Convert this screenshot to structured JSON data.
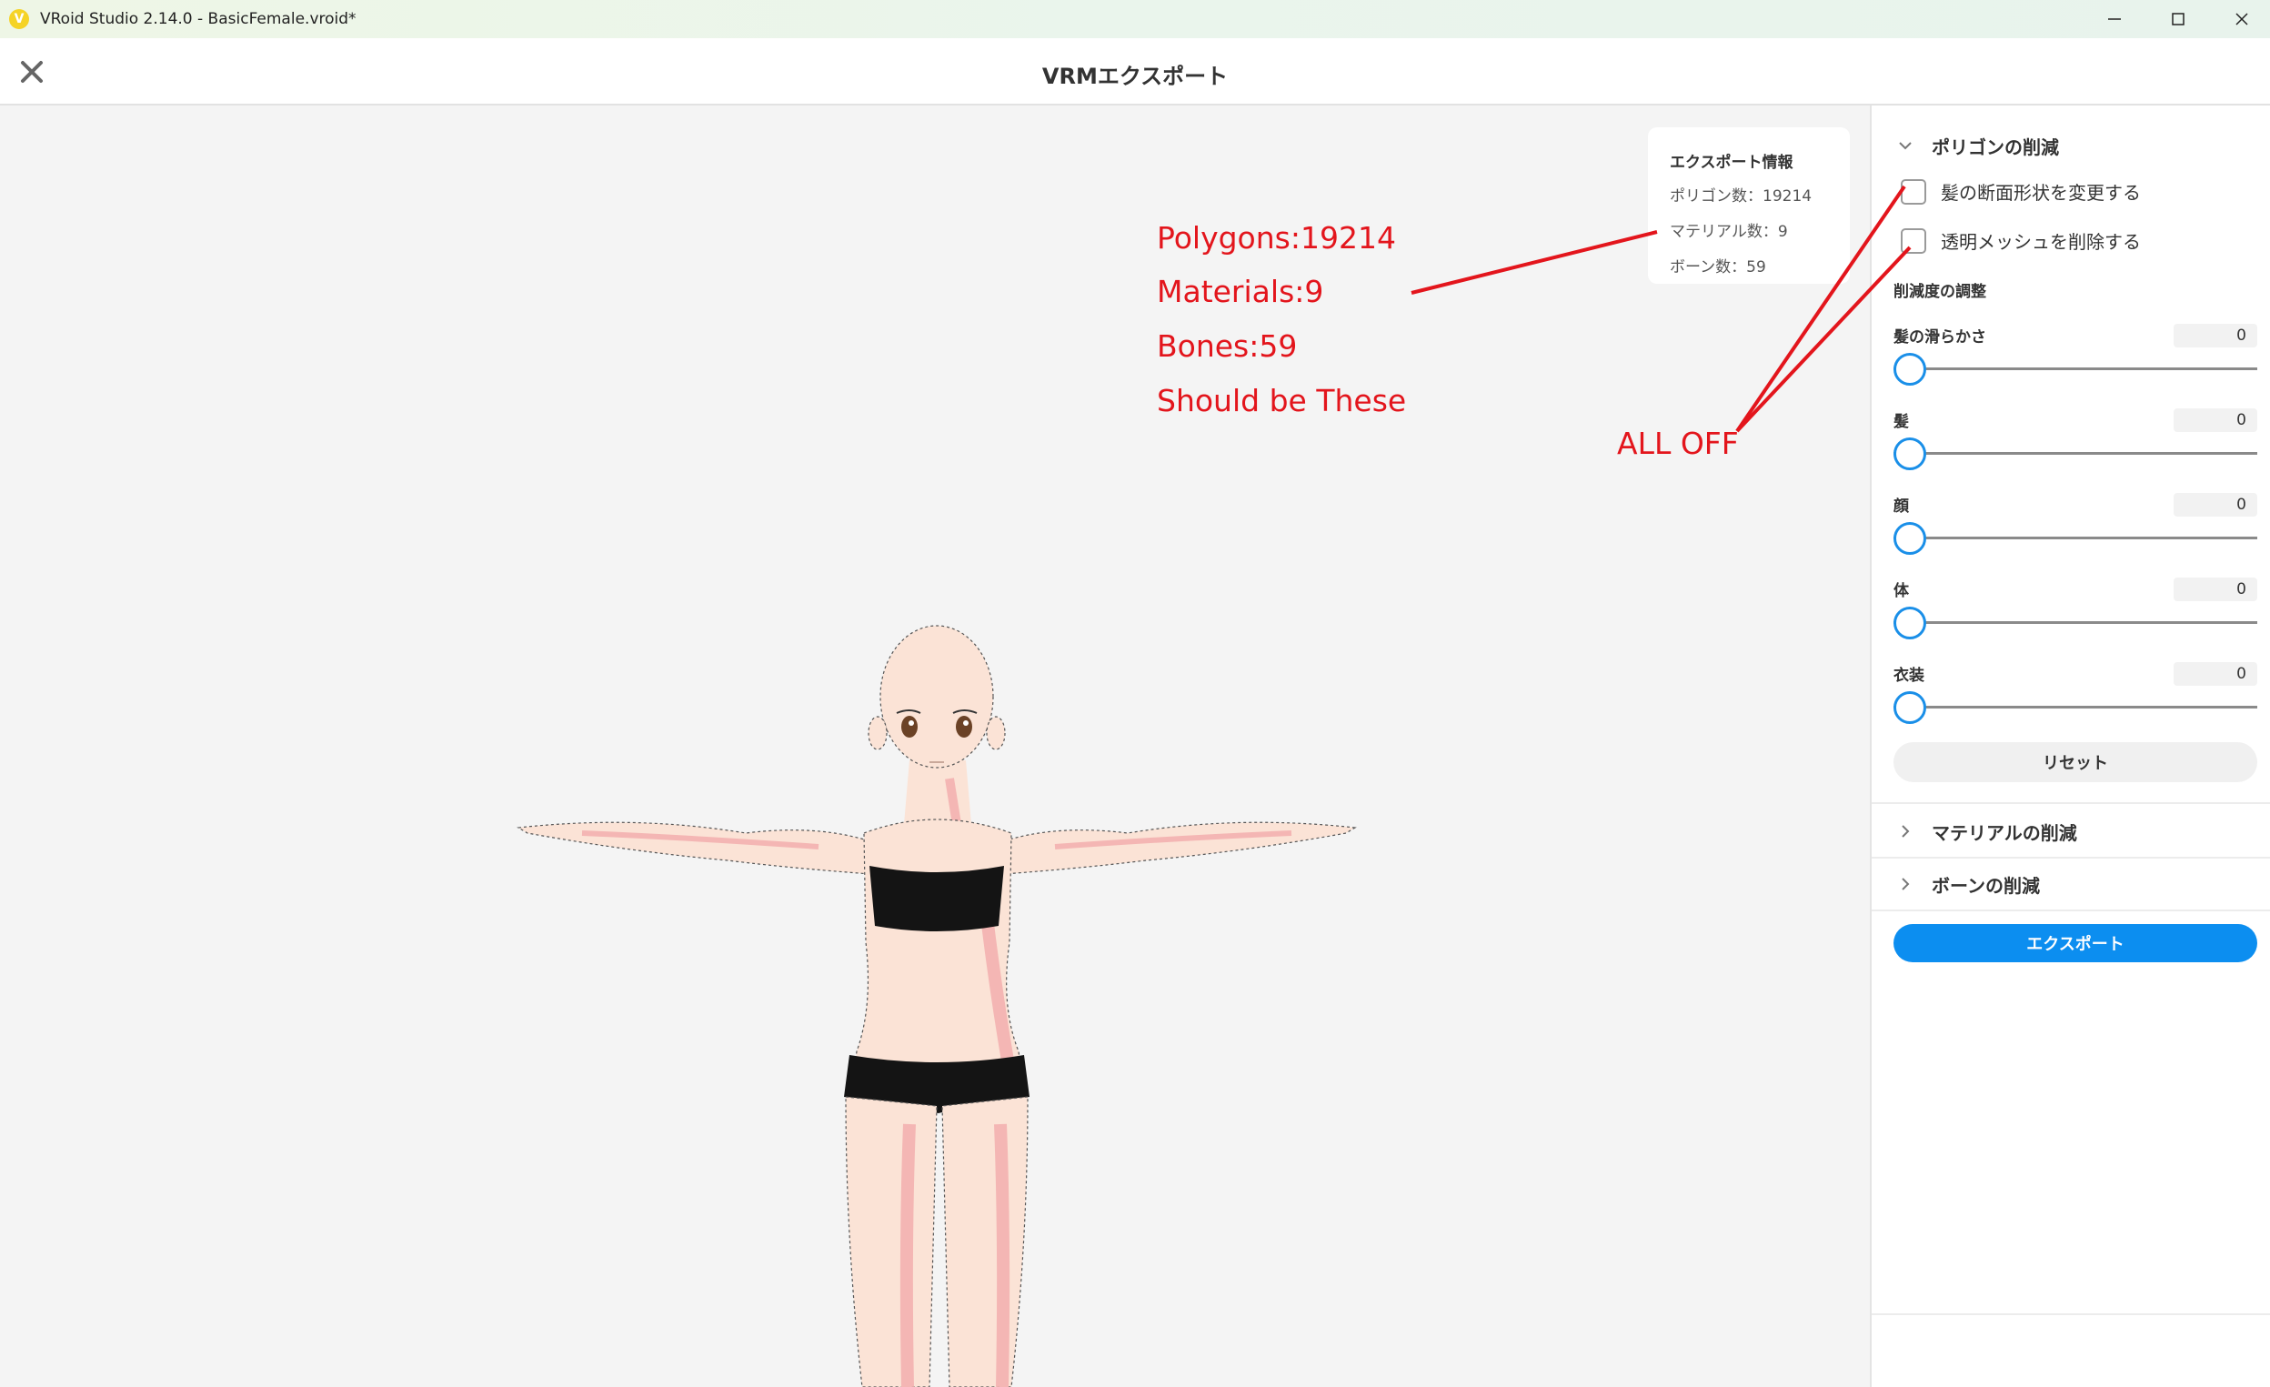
{
  "window": {
    "title": "VRoid Studio 2.14.0 - BasicFemale.vroid*",
    "logo": "vroid-logo-icon",
    "logo_letter": "V",
    "controls": [
      "minimize-icon",
      "maximize-icon",
      "close-icon"
    ]
  },
  "header": {
    "title": "VRMエクスポート",
    "close_icon": "close-icon"
  },
  "export_info": {
    "title": "エクスポート情報",
    "polygons": "ポリゴン数：19214",
    "materials": "マテリアル数：9",
    "bones": "ボーン数：59"
  },
  "annotations": {
    "line1": "Polygons:19214",
    "line2": "Materials:9",
    "line3": "Bones:59",
    "line4": "Should be These",
    "all_off": "ALL OFF",
    "color": "#e3151c"
  },
  "panel": {
    "polygon_section": {
      "label": "ポリゴンの削減",
      "expanded": true,
      "checkbox_hair": {
        "label": "髪の断面形状を変更する",
        "checked": false
      },
      "checkbox_transparent": {
        "label": "透明メッシュを削除する",
        "checked": false
      },
      "reduction_heading": "削減度の調整",
      "sliders": [
        {
          "label": "髪の滑らかさ",
          "value": "0"
        },
        {
          "label": "髪",
          "value": "0"
        },
        {
          "label": "顔",
          "value": "0"
        },
        {
          "label": "体",
          "value": "0"
        },
        {
          "label": "衣装",
          "value": "0"
        }
      ],
      "reset_label": "リセット"
    },
    "material_section": {
      "label": "マテリアルの削減",
      "expanded": false
    },
    "bone_section": {
      "label": "ボーンの削減",
      "expanded": false
    },
    "export_button": "エクスポート"
  },
  "colors": {
    "accent": "#0c8ef0",
    "slider_thumb": "#1a8fe8",
    "skin": "#fbe3d6",
    "clothing": "#141414"
  }
}
